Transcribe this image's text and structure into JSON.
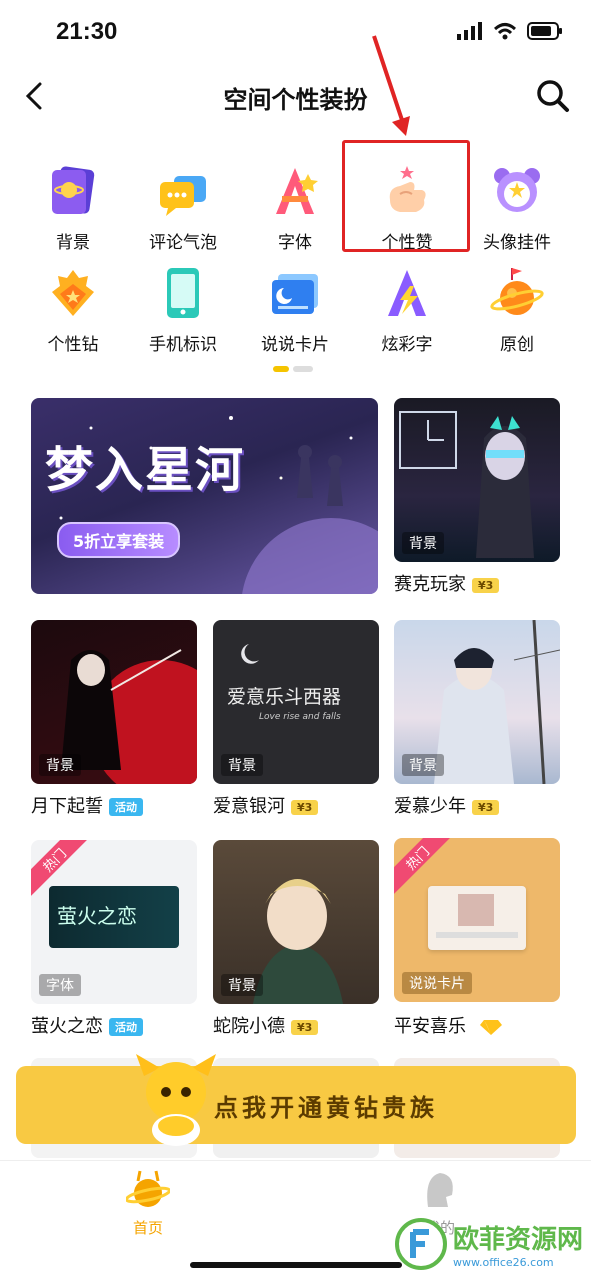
{
  "status": {
    "time": "21:30"
  },
  "nav": {
    "title": "空间个性装扮"
  },
  "categories": [
    {
      "label": "背景",
      "icon": "planet-card-icon"
    },
    {
      "label": "评论气泡",
      "icon": "chat-bubble-icon"
    },
    {
      "label": "字体",
      "icon": "font-a-icon"
    },
    {
      "label": "个性赞",
      "icon": "thumb-heart-icon"
    },
    {
      "label": "头像挂件",
      "icon": "avatar-pendant-icon"
    },
    {
      "label": "个性钻",
      "icon": "diamond-badge-icon"
    },
    {
      "label": "手机标识",
      "icon": "phone-icon"
    },
    {
      "label": "说说卡片",
      "icon": "moon-card-icon"
    },
    {
      "label": "炫彩字",
      "icon": "color-font-icon"
    },
    {
      "label": "原创",
      "icon": "rocket-planet-icon"
    }
  ],
  "banner": {
    "title": "梦入星河",
    "subtitle": "5折立享套装"
  },
  "items": [
    {
      "name": "赛克玩家",
      "tag": "背景",
      "badge": "¥3"
    },
    {
      "name": "月下起誓",
      "tag": "背景",
      "badge": "活动"
    },
    {
      "name": "爱意银河",
      "tag": "背景",
      "badge": "¥3",
      "art_text": "爱意乐斗西器",
      "art_sub": "Love rise and falls"
    },
    {
      "name": "爱慕少年",
      "tag": "背景",
      "badge": "¥3"
    },
    {
      "name": "萤火之恋",
      "tag": "字体",
      "badge": "活动",
      "hot": "热门",
      "art_text": "萤火之恋"
    },
    {
      "name": "蛇院小德",
      "tag": "背景",
      "badge": "¥3"
    },
    {
      "name": "平安喜乐",
      "tag": "说说卡片",
      "hot": "热门"
    }
  ],
  "vip": {
    "label": "点我开通黄钻贵族"
  },
  "tabs": [
    {
      "label": "首页"
    },
    {
      "label": "我的"
    }
  ],
  "watermark": {
    "title": "欧菲资源网",
    "url": "www.office26.com"
  },
  "colors": {
    "accent": "#f5c400",
    "highlight": "#e02424",
    "vip": "#f8c943"
  }
}
